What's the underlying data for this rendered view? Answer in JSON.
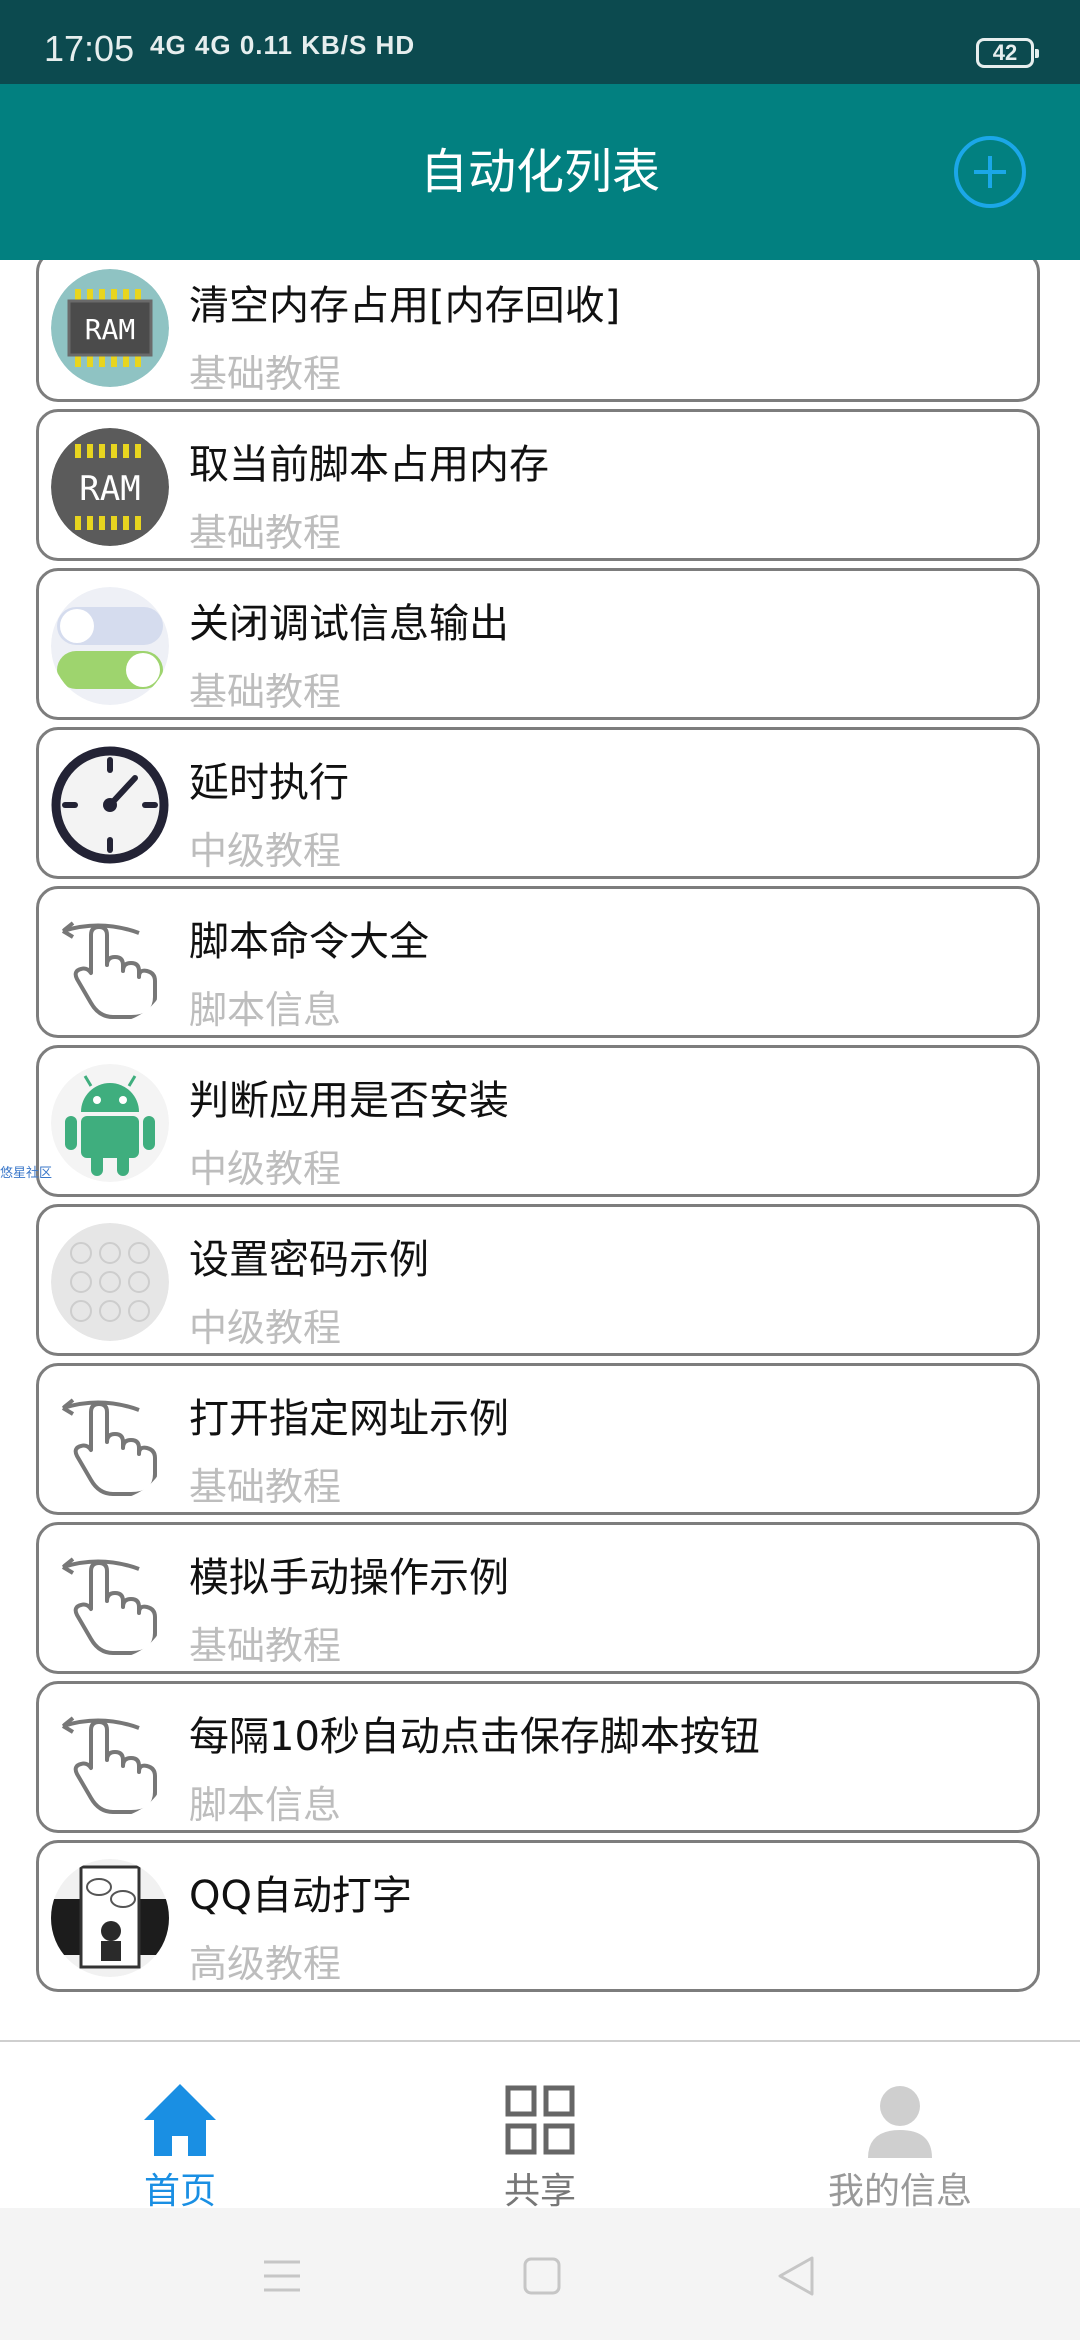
{
  "status_bar": {
    "time": "17:05",
    "signals": "4G 4G 0.11 KB/S HD",
    "battery": "42"
  },
  "app_bar": {
    "title": "自动化列表",
    "add_icon": "add-circle-icon"
  },
  "colors": {
    "app_bar": "#028080",
    "status_bar": "#0c4a4f",
    "accent": "#1ba7e8",
    "subtitle": "#bdbdbd"
  },
  "list": {
    "items": [
      {
        "title": "清空内存占用[内存回收]",
        "subtitle": "基础教程",
        "icon": "ram-chip-icon"
      },
      {
        "title": "取当前脚本占用内存",
        "subtitle": "基础教程",
        "icon": "ram-chip-icon"
      },
      {
        "title": "关闭调试信息输出",
        "subtitle": "基础教程",
        "icon": "toggle-switch-icon"
      },
      {
        "title": "延时执行",
        "subtitle": "中级教程",
        "icon": "stopwatch-icon"
      },
      {
        "title": "脚本命令大全",
        "subtitle": "脚本信息",
        "icon": "swipe-hand-icon"
      },
      {
        "title": "判断应用是否安装",
        "subtitle": "中级教程",
        "icon": "android-icon"
      },
      {
        "title": "设置密码示例",
        "subtitle": "中级教程",
        "icon": "pattern-lock-icon"
      },
      {
        "title": "打开指定网址示例",
        "subtitle": "基础教程",
        "icon": "swipe-hand-icon"
      },
      {
        "title": "模拟手动操作示例",
        "subtitle": "基础教程",
        "icon": "swipe-hand-icon"
      },
      {
        "title": "每隔10秒自动点击保存脚本按钮",
        "subtitle": "脚本信息",
        "icon": "swipe-hand-icon"
      },
      {
        "title": "QQ自动打字",
        "subtitle": "高级教程",
        "icon": "comic-image-icon"
      }
    ]
  },
  "side_watermark": "悠星社区",
  "bottom_nav": {
    "items": [
      {
        "label": "首页",
        "icon": "home-icon",
        "active": true
      },
      {
        "label": "共享",
        "icon": "grid-icon",
        "active": false
      },
      {
        "label": "我的信息",
        "icon": "user-icon",
        "active": false
      }
    ]
  },
  "system_nav": {
    "icons": [
      "menu-icon",
      "home-square-icon",
      "back-triangle-icon"
    ]
  }
}
